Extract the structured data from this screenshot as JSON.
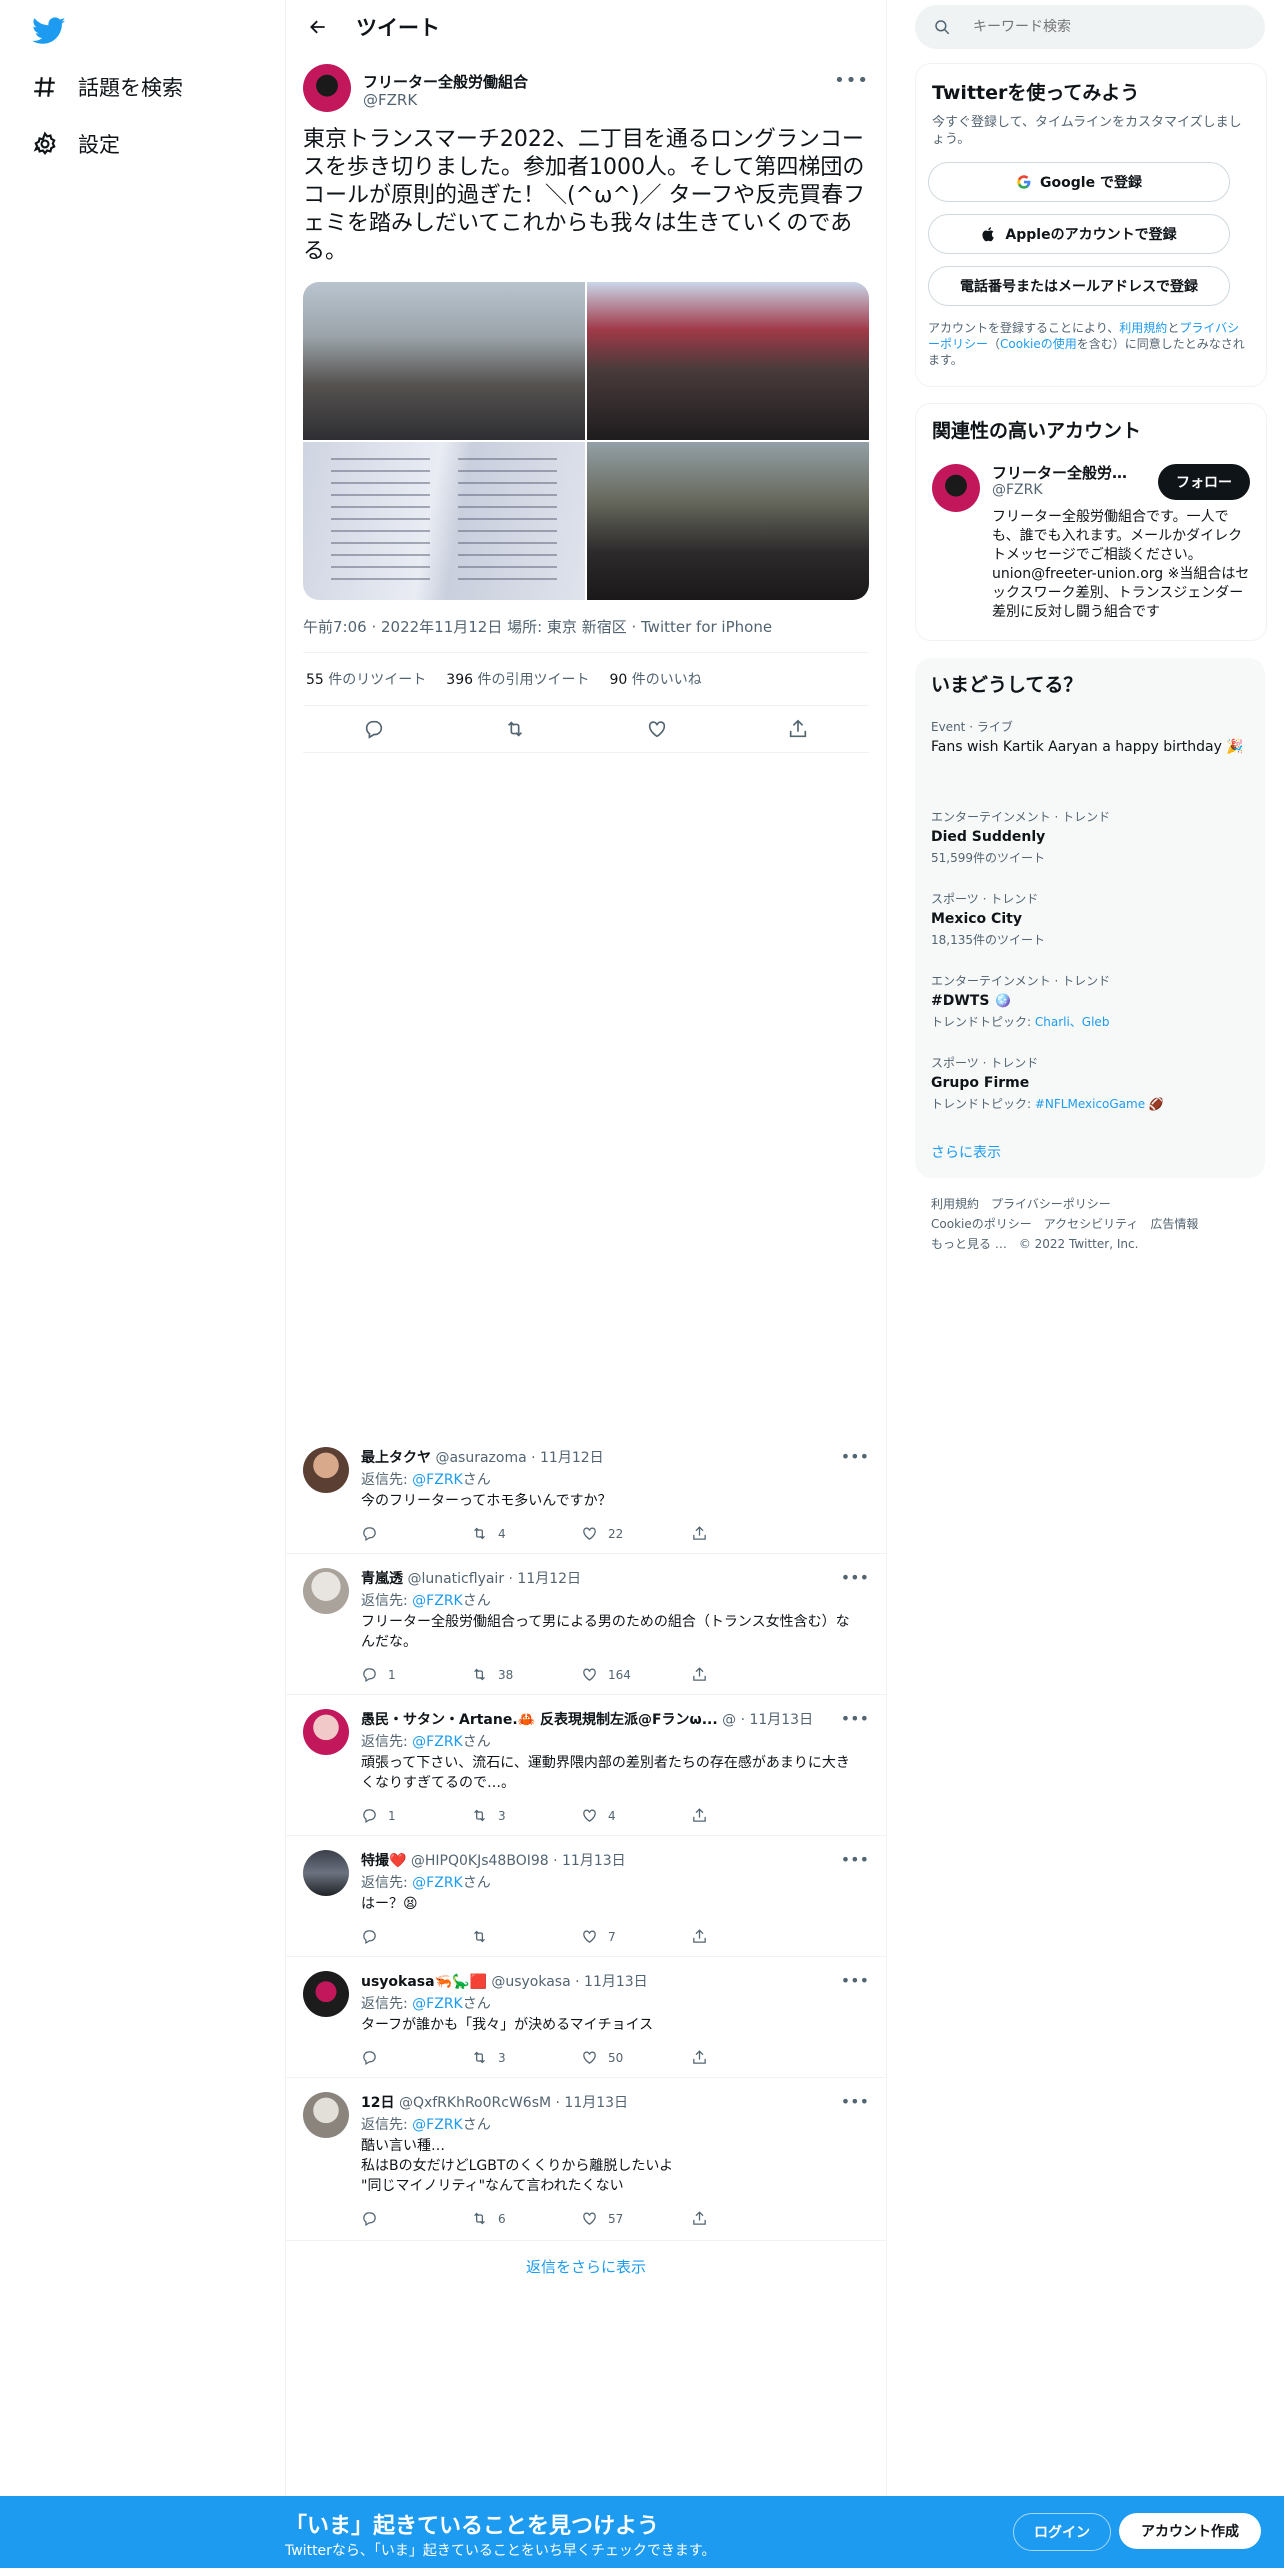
{
  "nav": {
    "explore_label": "話題を検索",
    "settings_label": "設定"
  },
  "header": {
    "title": "ツイート"
  },
  "tweet": {
    "author_name": "フリーター全般労働組合",
    "author_handle": "@FZRK",
    "text": "東京トランスマーチ2022、二丁目を通るロングランコースを歩き切りました。参加者1000人。そして第四梯団のコールが原則的過ぎた！＼(^ω^)／ ターフや反売買春フェミを踏みしだいてこれからも我々は生きていくのである。",
    "meta": "午前7:06 · 2022年11月12日 場所: 東京 新宿区 · Twitter for iPhone",
    "retweets_count": "55",
    "retweets_label": " 件のリツイート",
    "quotes_count": "396",
    "quotes_label": " 件の引用ツイート",
    "likes_count": "90",
    "likes_label": " 件のいいね"
  },
  "replies": [
    {
      "name": "最上タクヤ",
      "handle": "@asurazoma",
      "date": "· 11月12日",
      "to_prefix": "返信先: ",
      "to_handle": "@FZRK",
      "to_suffix": "さん",
      "text": "今のフリーターってホモ多いんですか？",
      "reply_count": "",
      "retweet_count": "4",
      "like_count": "22"
    },
    {
      "name": "青嵐透",
      "handle": "@lunaticflyair",
      "date": "· 11月12日",
      "to_prefix": "返信先: ",
      "to_handle": "@FZRK",
      "to_suffix": "さん",
      "text": "フリーター全般労働組合って男による男のための組合（トランス女性含む）なんだな。",
      "reply_count": "1",
      "retweet_count": "38",
      "like_count": "164"
    },
    {
      "name": "愚民・サタン・Artane.🦀 反表現規制左派@Fランω...",
      "handle": "@",
      "date": "· 11月13日",
      "to_prefix": "返信先: ",
      "to_handle": "@FZRK",
      "to_suffix": "さん",
      "text": "頑張って下さい、流石に、運動界隈内部の差別者たちの存在感があまりに大きくなりすぎてるので…。",
      "reply_count": "1",
      "retweet_count": "3",
      "like_count": "4"
    },
    {
      "name": "特撮❤️",
      "handle": "@HIPQ0KJs48BOI98",
      "date": "· 11月13日",
      "to_prefix": "返信先: ",
      "to_handle": "@FZRK",
      "to_suffix": "さん",
      "text": "はー？😫",
      "reply_count": "",
      "retweet_count": "",
      "like_count": "7"
    },
    {
      "name": "usyokasa🦐🦕🟥",
      "handle": "@usyokasa",
      "date": "· 11月13日",
      "to_prefix": "返信先: ",
      "to_handle": "@FZRK",
      "to_suffix": "さん",
      "text": "ターフが誰かも「我々」が決めるマイチョイス",
      "reply_count": "",
      "retweet_count": "3",
      "like_count": "50"
    },
    {
      "name": "12日",
      "handle": "@QxfRKhRo0RcW6sM",
      "date": "· 11月13日",
      "to_prefix": "返信先: ",
      "to_handle": "@FZRK",
      "to_suffix": "さん",
      "text_lines": [
        "酷い言い種…",
        "私はBの女だけどLGBTのくくりから離脱したいよ",
        "\"同じマイノリティ\"なんて言われたくない"
      ],
      "reply_count": "",
      "retweet_count": "6",
      "like_count": "57"
    }
  ],
  "show_more_replies": "返信をさらに表示",
  "sidebar": {
    "search_placeholder": "キーワード検索",
    "signup_title": "Twitterを使ってみよう",
    "signup_sub": "今すぐ登録して、タイムラインをカスタマイズしましょう。",
    "google_btn": "Google で登録",
    "apple_btn": "Appleのアカウントで登録",
    "phone_btn": "電話番号またはメールアドレスで登録",
    "terms_prefix": "アカウントを登録することにより、",
    "terms_link1": "利用規約",
    "terms_and": "と",
    "terms_link2": "プライバシーポリシー",
    "terms_paren_open": "（",
    "terms_link3": "Cookieの使用",
    "terms_suffix": "を含む）に同意したとみなされます。",
    "related_title": "関連性の高いアカウント",
    "related_name": "フリーター全般労働...",
    "related_handle": "@FZRK",
    "follow_label": "フォロー",
    "related_bio": "フリーター全般労働組合です。一人でも、誰でも入れます。メールかダイレクトメッセージでご相談ください。union@freeter-union.org ※当組合はセックスワーク差別、トランスジェンダー差別に反対し闘う組合です",
    "trends_title": "いまどうしてる？",
    "trends": [
      {
        "category": "Event · ライブ",
        "name": "Fans wish Kartik Aaryan a happy birthday 🎉",
        "sub": ""
      },
      {
        "category": "エンターテインメント · トレンド",
        "name": "Died Suddenly",
        "sub": "51,599件のツイート"
      },
      {
        "category": "スポーツ · トレンド",
        "name": "Mexico City",
        "sub": "18,135件のツイート"
      },
      {
        "category": "エンターテインメント · トレンド",
        "name": "#DWTS 🪩",
        "sub_prefix": "トレンドトピック: ",
        "sub_links": "Charli、Gleb"
      },
      {
        "category": "スポーツ · トレンド",
        "name": "Grupo Firme",
        "sub_prefix": "トレンドトピック: ",
        "sub_links": "#NFLMexicoGame 🏈"
      }
    ],
    "show_more": "さらに表示",
    "footer_line1": "利用規約　プライバシーポリシー",
    "footer_line2": "Cookieのポリシー　アクセシビリティ　広告情報",
    "footer_line3": "もっと見る …　© 2022 Twitter, Inc."
  },
  "bottom_bar": {
    "title": "「いま」起きていることを見つけよう",
    "sub": "Twitterなら、「いま」起きていることをいち早くチェックできます。",
    "login": "ログイン",
    "create": "アカウント作成"
  },
  "colors": {
    "accent": "#1d9bf0",
    "text": "#0f1419",
    "secondary": "#536471"
  }
}
